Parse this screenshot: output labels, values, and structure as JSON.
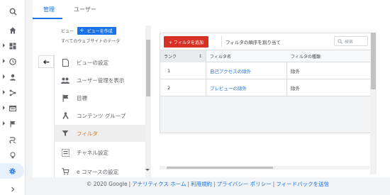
{
  "rail": {
    "items": [
      {
        "icon": "search-icon"
      },
      {
        "icon": "home-icon"
      },
      {
        "icon": "dashboard-icon"
      },
      {
        "icon": "clock-icon"
      },
      {
        "icon": "person-icon"
      },
      {
        "icon": "acquisition-icon"
      },
      {
        "icon": "behavior-icon"
      },
      {
        "icon": "flag-icon"
      },
      {
        "icon": "attribution-icon"
      },
      {
        "icon": "lightbulb-icon"
      },
      {
        "icon": "gear-icon"
      },
      {
        "icon": "chevron-right-icon"
      }
    ]
  },
  "tabs": {
    "admin": "管理",
    "user": "ユーザー"
  },
  "nav": {
    "view_label": "ビュー",
    "create_button": "ビューを作成",
    "view_name": "すべてのウェブサイトのデータ",
    "items": [
      {
        "label": "ビューの設定",
        "icon": "document-icon"
      },
      {
        "label": "ユーザー管理を表示",
        "icon": "people-icon"
      },
      {
        "label": "目標",
        "icon": "flag-icon"
      },
      {
        "label": "コンテンツ グループ",
        "icon": "content-group-icon"
      },
      {
        "label": "フィルタ",
        "icon": "filter-icon"
      },
      {
        "label": "チャネル設定",
        "icon": "channel-icon"
      },
      {
        "label": "e コマースの設定",
        "icon": "cart-icon"
      }
    ],
    "active_index": 4
  },
  "content": {
    "add_filter": "+ フィルタを追加",
    "order_filters": "フィルタの順序を割り当て",
    "search_placeholder": "検索",
    "columns": [
      "ランク",
      "フィルタ名",
      "フィルタの種類"
    ],
    "rows": [
      {
        "rank": "1",
        "name": "自己アクセスの除外",
        "type": "除外"
      },
      {
        "rank": "2",
        "name": "プレビューの除外",
        "type": "除外"
      }
    ]
  },
  "footer": {
    "copyright": "© 2020 Google",
    "links": [
      "アナリティクス ホーム",
      "利用規約",
      "プライバシー ポリシー",
      "フィードバックを送信"
    ]
  },
  "colors": {
    "accent": "#1a73e8",
    "active_nav": "#e8710a",
    "add_button": "#d93025"
  }
}
